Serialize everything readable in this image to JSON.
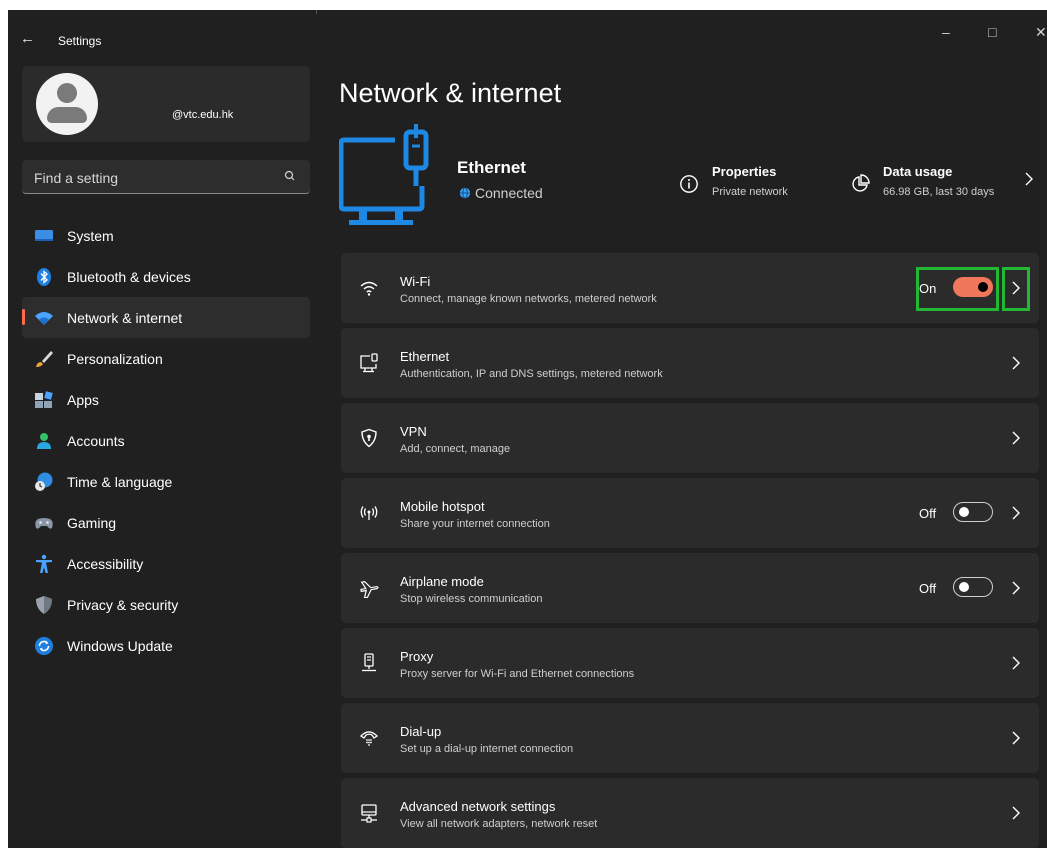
{
  "window": {
    "title": "Settings",
    "back_icon": "back-arrow-icon",
    "minimize": "–",
    "maximize": "□",
    "close": "✕"
  },
  "profile": {
    "email": "@vtc.edu.hk"
  },
  "search": {
    "placeholder": "Find a setting"
  },
  "sidebar": {
    "items": [
      {
        "label": "System",
        "icon": "system-display-icon",
        "active": false
      },
      {
        "label": "Bluetooth & devices",
        "icon": "bluetooth-icon",
        "active": false
      },
      {
        "label": "Network & internet",
        "icon": "wifi-icon",
        "active": true
      },
      {
        "label": "Personalization",
        "icon": "paintbrush-icon",
        "active": false
      },
      {
        "label": "Apps",
        "icon": "apps-icon",
        "active": false
      },
      {
        "label": "Accounts",
        "icon": "account-icon",
        "active": false
      },
      {
        "label": "Time & language",
        "icon": "globe-clock-icon",
        "active": false
      },
      {
        "label": "Gaming",
        "icon": "gamepad-icon",
        "active": false
      },
      {
        "label": "Accessibility",
        "icon": "accessibility-icon",
        "active": false
      },
      {
        "label": "Privacy & security",
        "icon": "shield-icon",
        "active": false
      },
      {
        "label": "Windows Update",
        "icon": "update-icon",
        "active": false
      }
    ]
  },
  "page": {
    "title": "Network & internet",
    "connection": {
      "name": "Ethernet",
      "status": "Connected",
      "icon": "ethernet-monitor-icon"
    },
    "properties": {
      "title": "Properties",
      "subtitle": "Private network",
      "icon": "info-icon"
    },
    "data_usage": {
      "title": "Data usage",
      "subtitle": "66.98 GB, last 30 days",
      "icon": "pie-chart-icon"
    }
  },
  "cards": [
    {
      "title": "Wi-Fi",
      "subtitle": "Connect, manage known networks, metered network",
      "icon": "wifi-icon",
      "toggle": "On"
    },
    {
      "title": "Ethernet",
      "subtitle": "Authentication, IP and DNS settings, metered network",
      "icon": "ethernet-icon"
    },
    {
      "title": "VPN",
      "subtitle": "Add, connect, manage",
      "icon": "vpn-shield-icon"
    },
    {
      "title": "Mobile hotspot",
      "subtitle": "Share your internet connection",
      "icon": "hotspot-icon",
      "toggle": "Off"
    },
    {
      "title": "Airplane mode",
      "subtitle": "Stop wireless communication",
      "icon": "airplane-icon",
      "toggle": "Off"
    },
    {
      "title": "Proxy",
      "subtitle": "Proxy server for Wi-Fi and Ethernet connections",
      "icon": "proxy-icon"
    },
    {
      "title": "Dial-up",
      "subtitle": "Set up a dial-up internet connection",
      "icon": "dialup-icon"
    },
    {
      "title": "Advanced network settings",
      "subtitle": "View all network adapters, network reset",
      "icon": "advanced-network-icon"
    }
  ],
  "colors": {
    "accent": "#f0765c",
    "highlight": "#22b833",
    "window_bg": "#202020",
    "card_bg": "#2b2b2b",
    "ethernet_blue": "#1e88e5"
  }
}
